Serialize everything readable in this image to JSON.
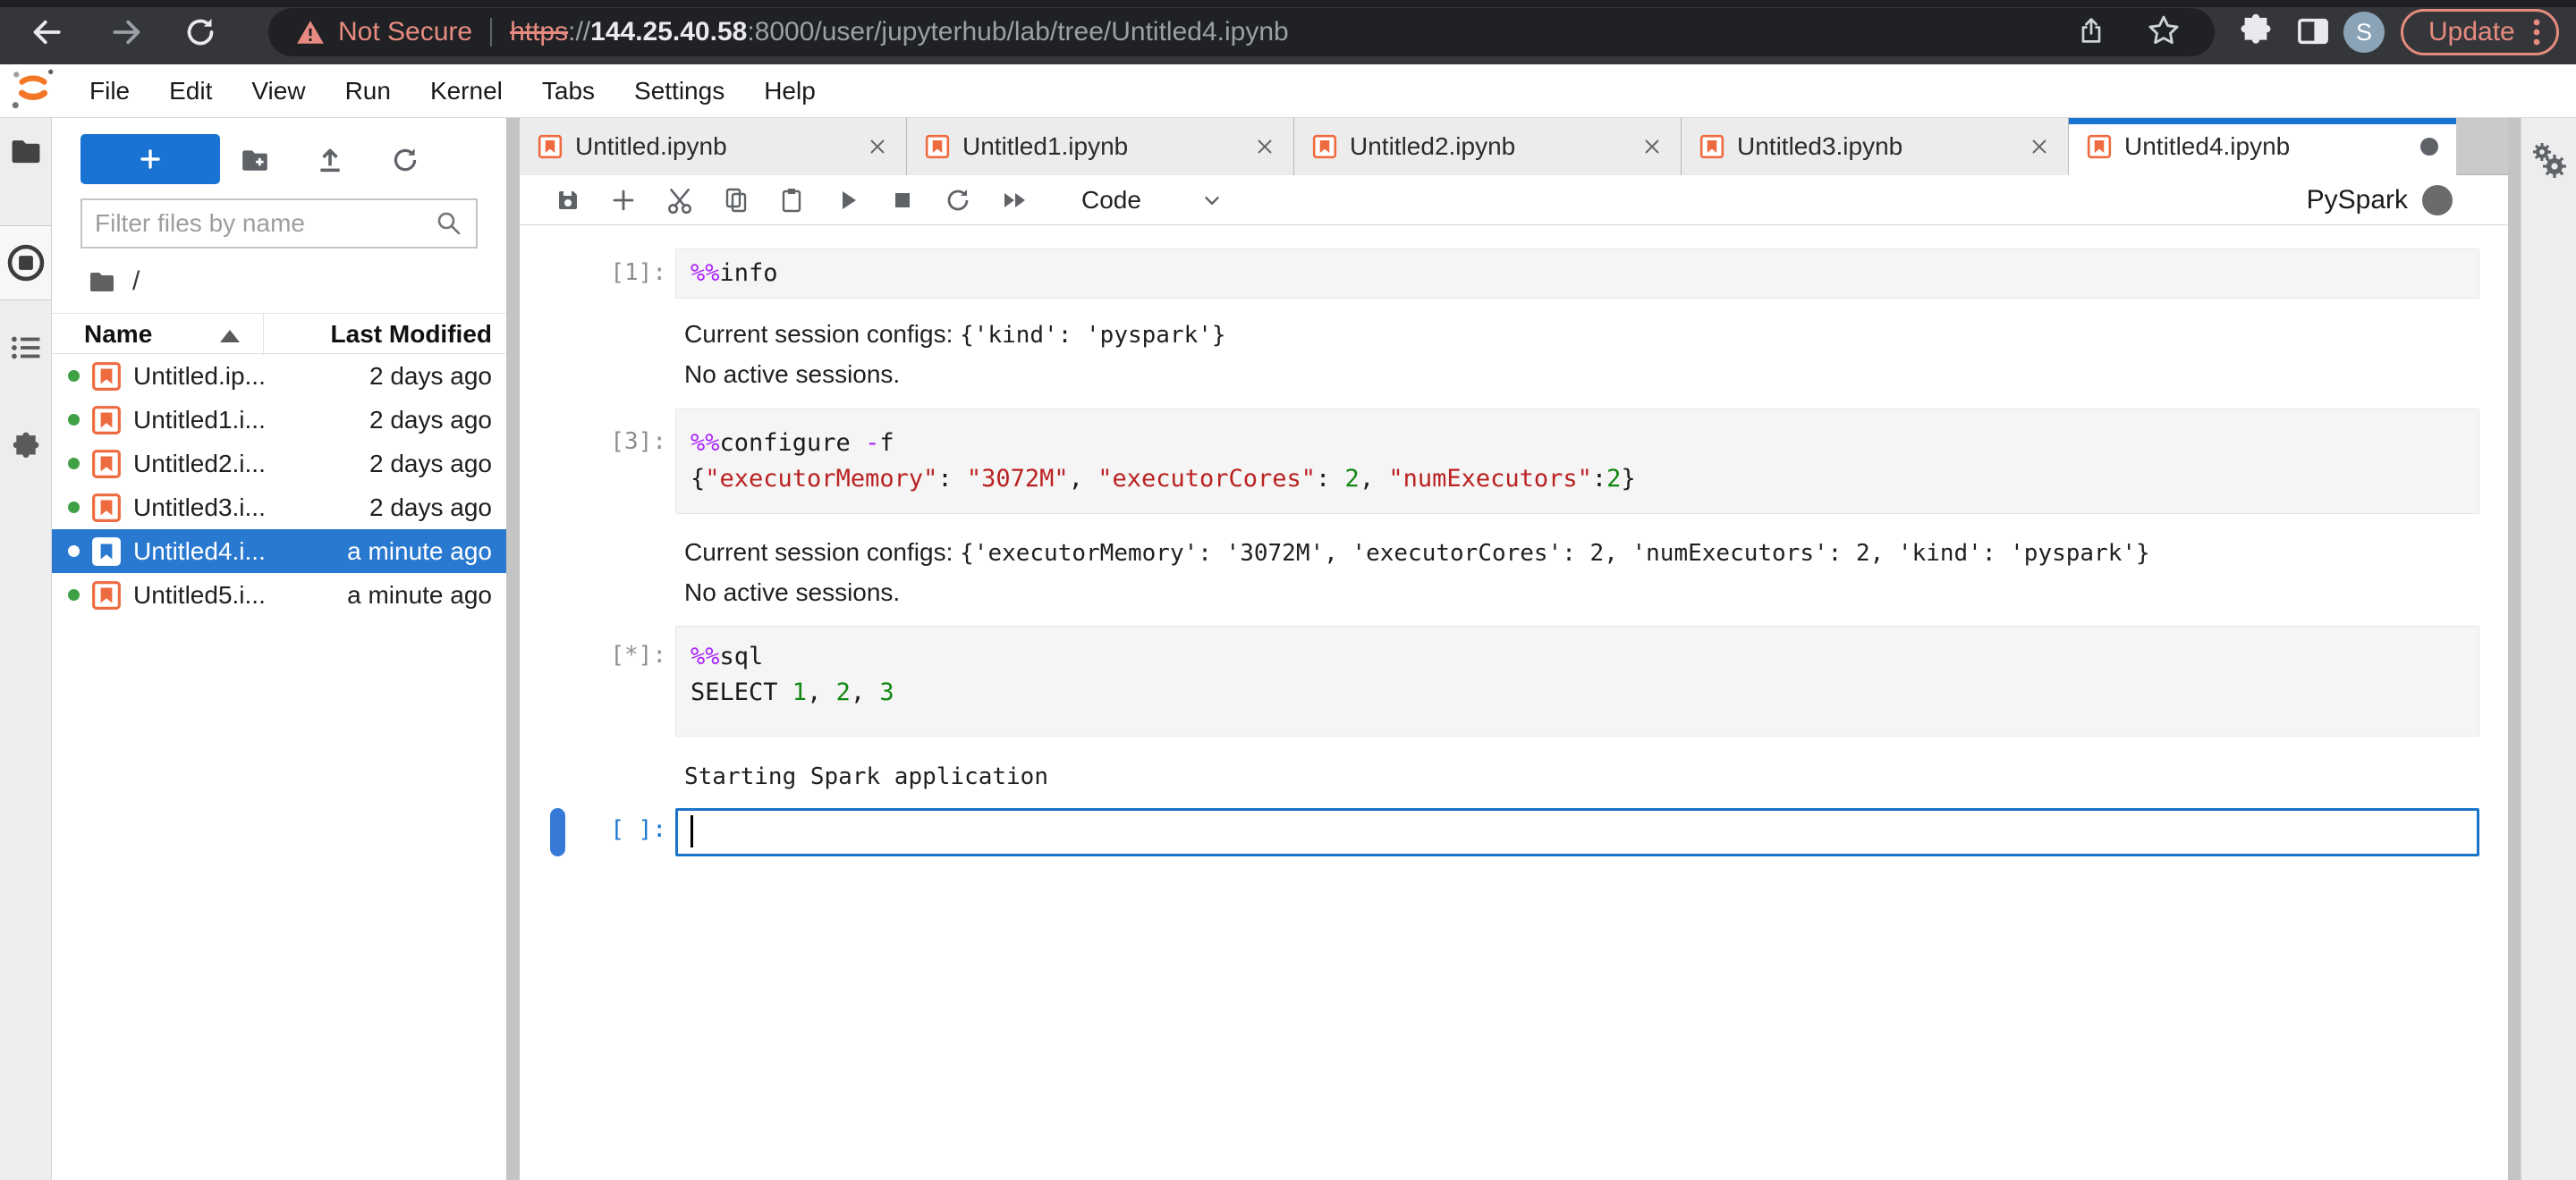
{
  "colors": {
    "accent_blue": "#1873D3",
    "selection_blue": "#2A79D0",
    "jupyter_orange": "#F37726",
    "warning_salmon": "#E78B80",
    "string_red": "#BA2121",
    "number_green": "#118811",
    "magic_purple": "#AA22FF",
    "cell_background": "#F5F5F5",
    "kernel_busy_gray": "#6B6B6B",
    "running_green_dot": "#3FA045"
  },
  "browser": {
    "security_warning": "Not Secure",
    "url": {
      "scheme": "https",
      "separator": "://",
      "host": "144.25.40.58",
      "path": ":8000/user/jupyterhub/lab/tree/Untitled4.ipynb"
    },
    "avatar_initial": "S",
    "update_button": "Update"
  },
  "menubar": {
    "items": [
      "File",
      "Edit",
      "View",
      "Run",
      "Kernel",
      "Tabs",
      "Settings",
      "Help"
    ]
  },
  "filebrowser": {
    "filter_placeholder": "Filter files by name",
    "breadcrumb_root": "/",
    "header": {
      "name": "Name",
      "modified": "Last Modified"
    },
    "rows": [
      {
        "name": "Untitled.ip...",
        "modified": "2 days ago"
      },
      {
        "name": "Untitled1.i...",
        "modified": "2 days ago"
      },
      {
        "name": "Untitled2.i...",
        "modified": "2 days ago"
      },
      {
        "name": "Untitled3.i...",
        "modified": "2 days ago"
      },
      {
        "name": "Untitled4.i...",
        "modified": "a minute ago"
      },
      {
        "name": "Untitled5.i...",
        "modified": "a minute ago"
      }
    ]
  },
  "tabbar": {
    "tabs": [
      {
        "label": "Untitled.ipynb"
      },
      {
        "label": "Untitled1.ipynb"
      },
      {
        "label": "Untitled2.ipynb"
      },
      {
        "label": "Untitled3.ipynb"
      },
      {
        "label": "Untitled4.ipynb"
      }
    ]
  },
  "nbtoolbar": {
    "cell_type": "Code",
    "kernel_name": "PySpark"
  },
  "notebook": {
    "cell1": {
      "prompt": "[1]:",
      "magic": "%%",
      "cmd": "info"
    },
    "out1": {
      "label": "Current session configs: ",
      "config": "{'kind': 'pyspark'}",
      "line2": "No active sessions."
    },
    "cell2": {
      "prompt": "[3]:",
      "magic": "%%",
      "cmd": "configure ",
      "op": "-",
      "flag": "f",
      "j_open": "{",
      "k1": "\"executorMemory\"",
      "p1": ": ",
      "v1": "\"3072M\"",
      "s1": ", ",
      "k2": "\"executorCores\"",
      "p2": ": ",
      "n1": "2",
      "s2": ", ",
      "k3": "\"numExecutors\"",
      "p3": ":",
      "n2": "2",
      "j_close": "}"
    },
    "out2": {
      "label": "Current session configs: ",
      "config": "{'executorMemory': '3072M', 'executorCores': 2, 'numExecutors': 2, 'kind': 'pyspark'}",
      "line2": "No active sessions."
    },
    "cell3": {
      "prompt": "[*]:",
      "magic": "%%",
      "cmd": "sql",
      "kw": "SELECT ",
      "n1": "1",
      "s1": ", ",
      "n2": "2",
      "s2": ", ",
      "n3": "3"
    },
    "out3": {
      "text": "Starting Spark application"
    },
    "cell4": {
      "prompt": "[ ]:"
    }
  }
}
